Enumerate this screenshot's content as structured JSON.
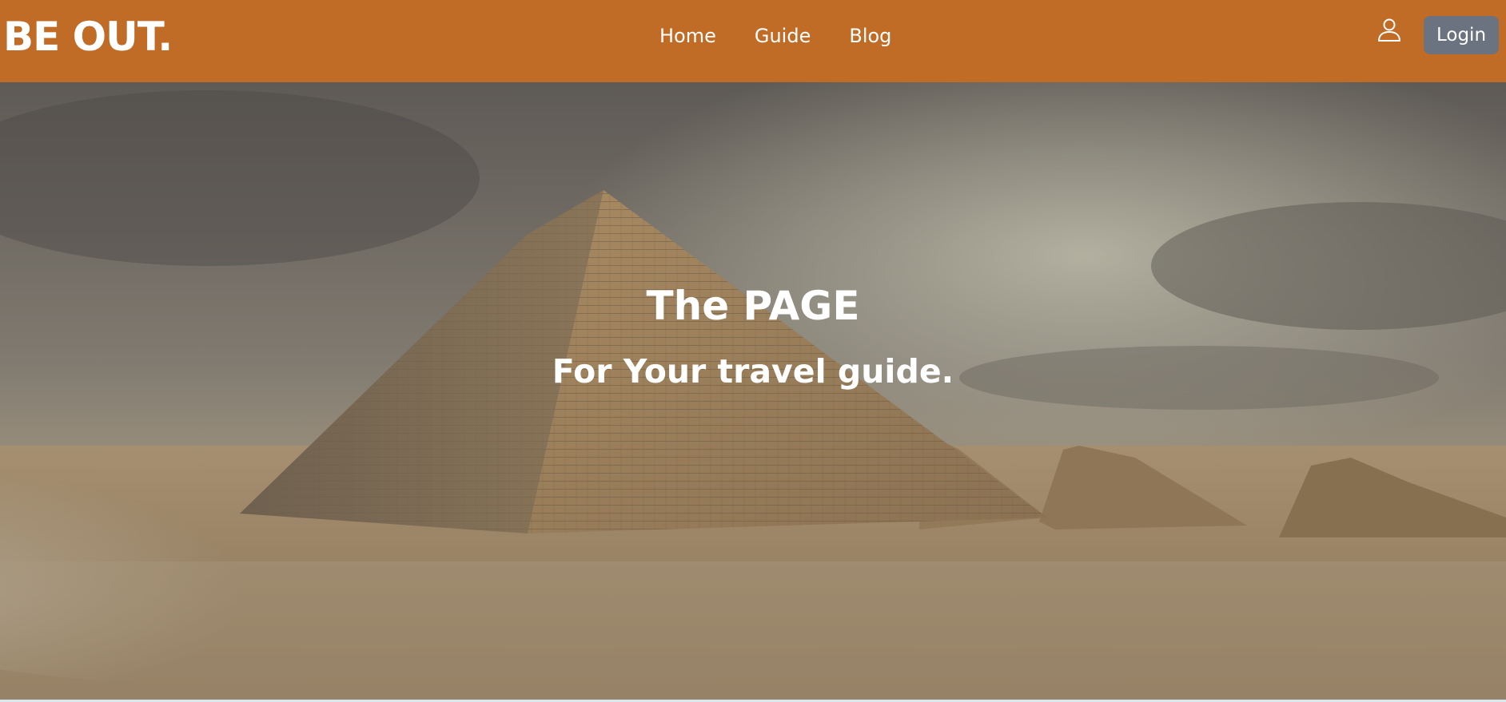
{
  "header": {
    "brand": "BE OUT.",
    "nav": [
      {
        "label": "Home"
      },
      {
        "label": "Guide"
      },
      {
        "label": "Blog"
      }
    ],
    "user_icon": "user-icon",
    "login_label": "Login"
  },
  "hero": {
    "title": "The PAGE",
    "subtitle": "For Your travel guide.",
    "background_image": "pyramids-desert-photo"
  },
  "colors": {
    "navbar": "#c06c27",
    "login_button": "#6b7280",
    "text": "#ffffff"
  }
}
